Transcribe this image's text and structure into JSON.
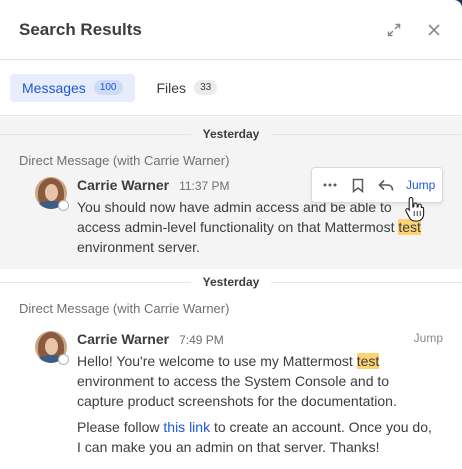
{
  "header": {
    "title": "Search Results"
  },
  "tabs": [
    {
      "label": "Messages",
      "count": "100"
    },
    {
      "label": "Files",
      "count": "33"
    }
  ],
  "results": [
    {
      "date": "Yesterday",
      "channel": "Direct Message (with Carrie Warner)",
      "author": "Carrie Warner",
      "time": "11:37 PM",
      "jump_label": "Jump",
      "message": {
        "part1": "You should now have admin access and be able to access admin-level functionality on that Mattermost ",
        "highlight": "test",
        "part2": " environment server."
      }
    },
    {
      "date": "Yesterday",
      "channel": "Direct Message (with Carrie Warner)",
      "author": "Carrie Warner",
      "time": "7:49 PM",
      "jump_label": "Jump",
      "message": {
        "part1": "Hello! You're welcome to use my Mattermost ",
        "highlight": "test",
        "part2": " environment to access the System Console and to capture product screenshots for the documentation.",
        "para2_before": "Please follow ",
        "para2_link": "this link",
        "para2_after": " to create an account. Once you do, I can make you an admin on that server. Thanks!"
      }
    }
  ],
  "colors": {
    "accent": "#1c58d9",
    "highlight": "#ffd470",
    "hover_bg": "#f4f4f5"
  }
}
